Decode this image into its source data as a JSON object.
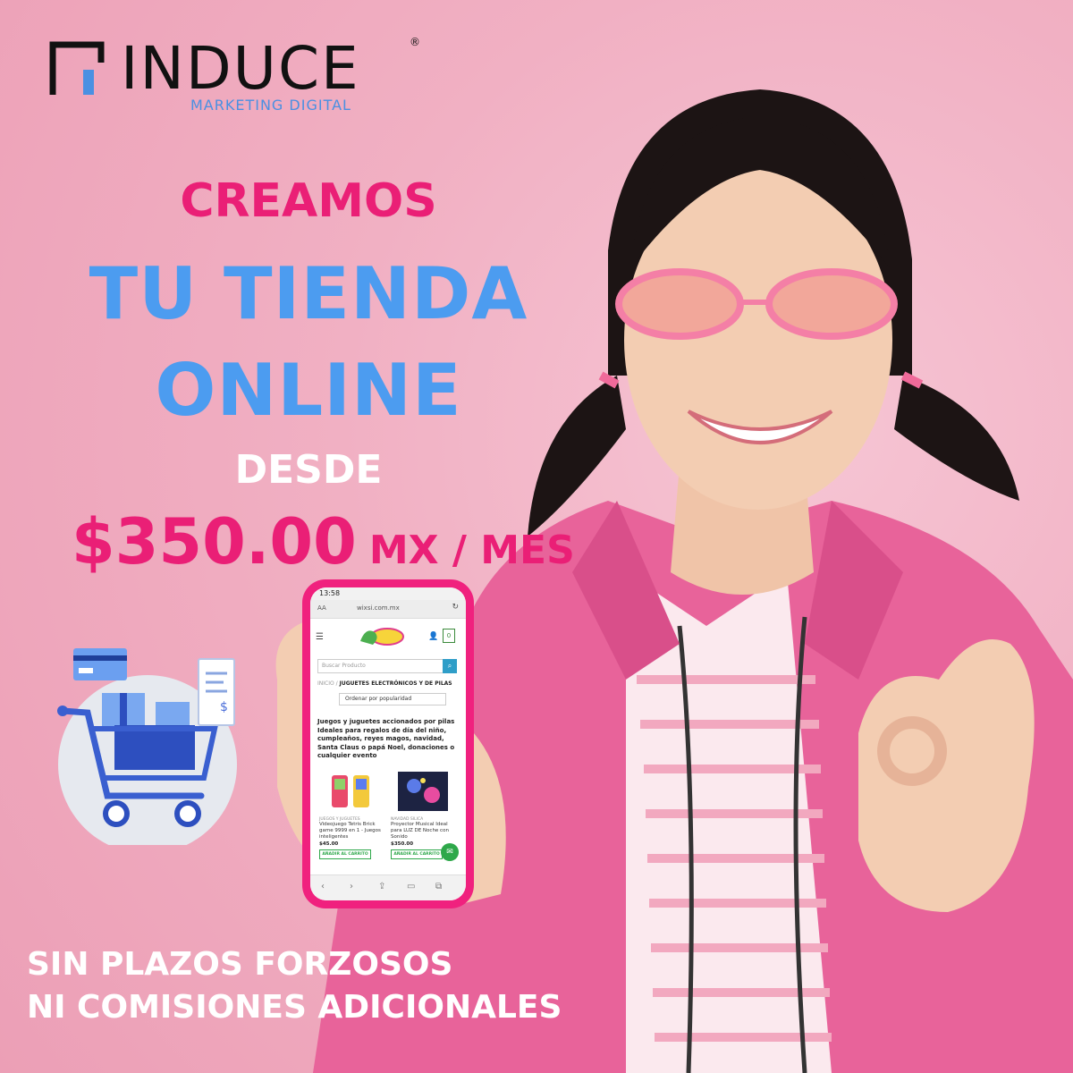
{
  "brand": {
    "name": "INDUCE",
    "registered": "®",
    "tagline": "MARKETING DIGITAL",
    "accent_color": "#4a90e2"
  },
  "headline": {
    "line1": "CREAMOS",
    "line2": "TU TIENDA",
    "line3": "ONLINE",
    "line4": "DESDE"
  },
  "price": {
    "amount": "$350.00",
    "unit": "MX / MES"
  },
  "footer": {
    "line1": "SIN PLAZOS FORZOSOS",
    "line2": "NI COMISIONES ADICIONALES"
  },
  "colors": {
    "background": "#f1b0c3",
    "pink": "#ea1f76",
    "blue": "#4c9cf0",
    "white": "#ffffff"
  },
  "phone": {
    "status_time": "13:58",
    "text_size_label": "AA",
    "url": "wixsi.com.mx",
    "search_placeholder": "Buscar Producto",
    "breadcrumb_home": "INICIO",
    "breadcrumb_sep": "/",
    "breadcrumb_current": "JUGUETES ELECTRÓNICOS Y DE PILAS",
    "sort_label": "Ordenar por popularidad",
    "description": "Juegos y juguetes accionados por pilas Ideales para regalos de día del niño, cumpleaños, reyes magos, navidad, Santa Claus o papá Noel, donaciones o cualquier evento",
    "products": [
      {
        "category": "JUEGOS Y JUGUETES",
        "name": "Videojuego Tetris Brick game 9999 en 1 - Juegos inteligentes",
        "price": "$45.00",
        "button": "AÑADIR AL CARRITO"
      },
      {
        "category": "NAVIDAD SILICA",
        "name": "Proyector Musical Ideal para LUZ DE Noche con Sonido",
        "price": "$350.00",
        "button": "AÑADIR AL CARRITO"
      }
    ],
    "icons": [
      "menu-icon",
      "user-icon",
      "bag-icon",
      "search-icon",
      "reload-icon",
      "messenger-icon",
      "back-icon",
      "forward-icon",
      "share-icon",
      "bookmarks-icon",
      "tabs-icon"
    ]
  }
}
